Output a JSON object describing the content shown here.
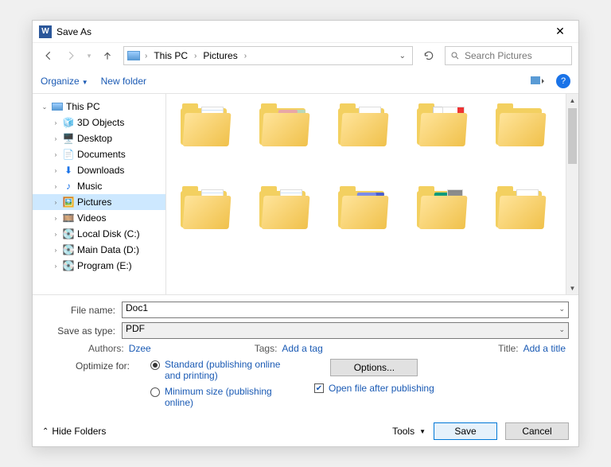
{
  "title": "Save As",
  "breadcrumb": {
    "root": "This PC",
    "current": "Pictures"
  },
  "search": {
    "placeholder": "Search Pictures"
  },
  "toolbar": {
    "organize": "Organize",
    "new_folder": "New folder"
  },
  "tree": {
    "root": "This PC",
    "items": [
      {
        "label": "3D Objects"
      },
      {
        "label": "Desktop"
      },
      {
        "label": "Documents"
      },
      {
        "label": "Downloads"
      },
      {
        "label": "Music"
      },
      {
        "label": "Pictures",
        "selected": true
      },
      {
        "label": "Videos"
      },
      {
        "label": "Local Disk (C:)"
      },
      {
        "label": "Main Data (D:)"
      },
      {
        "label": "Program (E:)"
      }
    ]
  },
  "form": {
    "filename_label": "File name:",
    "filename": "Doc1",
    "type_label": "Save as type:",
    "type": "PDF",
    "authors_label": "Authors:",
    "authors": "Dzee",
    "tags_label": "Tags:",
    "tags": "Add a tag",
    "title_label": "Title:",
    "title": "Add a title",
    "optimize_label": "Optimize for:",
    "opt_standard": "Standard (publishing online and printing)",
    "opt_min": "Minimum size (publishing online)",
    "options_btn": "Options...",
    "open_after": "Open file after publishing"
  },
  "footer": {
    "hide": "Hide Folders",
    "tools": "Tools",
    "save": "Save",
    "cancel": "Cancel"
  }
}
